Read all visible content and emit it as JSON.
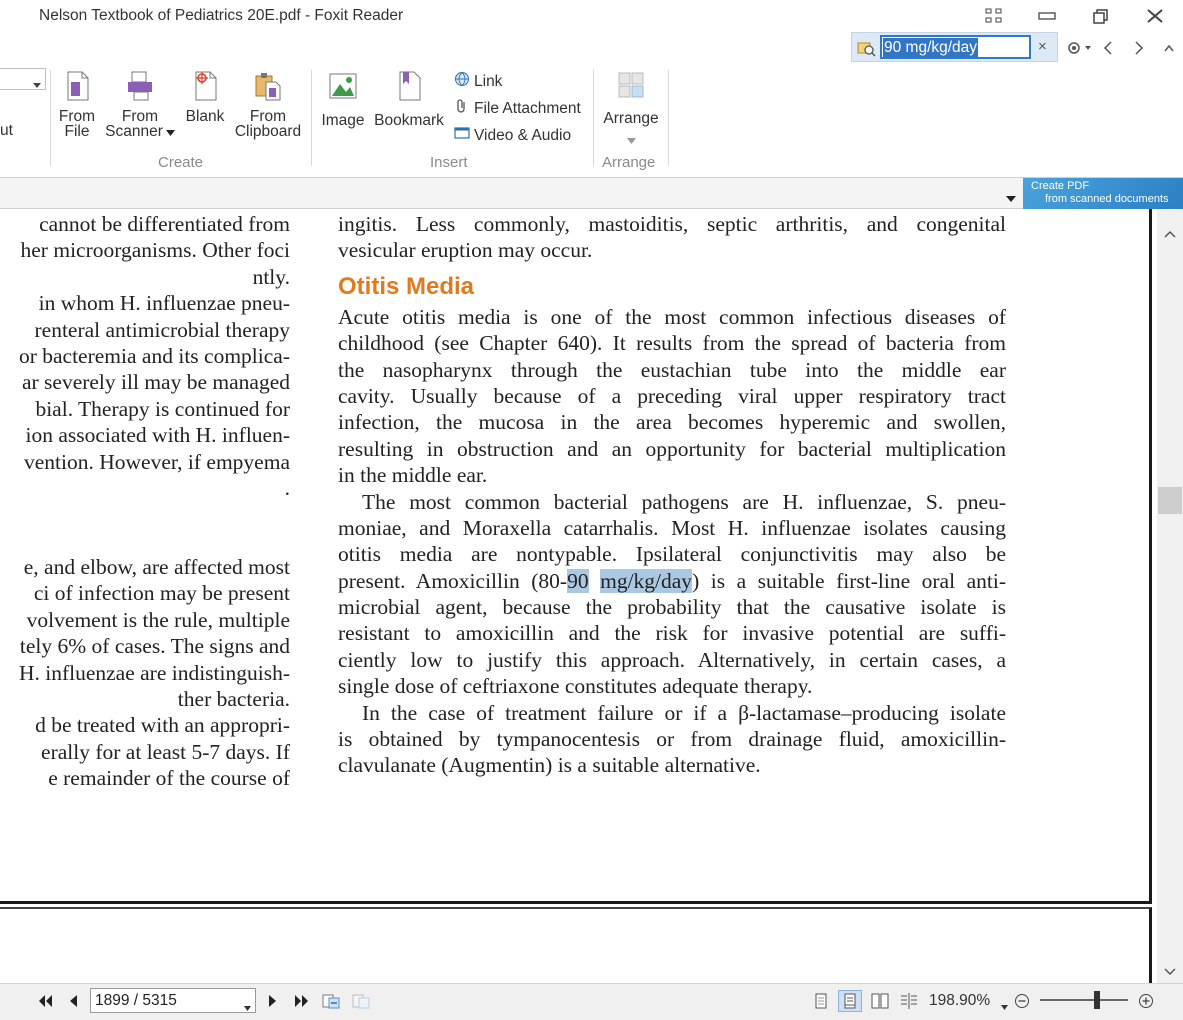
{
  "window": {
    "title": "Nelson Textbook of Pediatrics 20E.pdf - Foxit Reader"
  },
  "find": {
    "query": "90 mg/kg/day",
    "clear_glyph": "×"
  },
  "ribbon": {
    "partial_left_label": "ut",
    "create": {
      "from_file": [
        "From",
        "File"
      ],
      "from_scanner": [
        "From",
        "Scanner"
      ],
      "blank": "Blank",
      "from_clipboard": [
        "From",
        "Clipboard"
      ],
      "group_label": "Create"
    },
    "insert": {
      "image": "Image",
      "bookmark": "Bookmark",
      "link": "Link",
      "file_attachment": "File Attachment",
      "video_audio": "Video & Audio",
      "group_label": "Insert"
    },
    "arrange": {
      "arrange": "Arrange",
      "group_label": "Arrange"
    }
  },
  "promo": {
    "line1": "Create PDF",
    "line2": "from scanned documents"
  },
  "document": {
    "left_column": [
      "cannot be differentiated from",
      "her microorganisms. Other foci",
      "ntly.",
      "in whom H. influenzae pneu-",
      "renteral antimicrobial therapy",
      "or bacteremia and its complica-",
      "ar severely ill may be managed",
      "bial. Therapy is continued for",
      "ion associated with H. influen-",
      "vention. However, if empyema",
      ".",
      "",
      "",
      "e, and elbow, are affected most",
      "ci of infection may be present",
      "volvement is the rule, multiple",
      "tely 6% of cases. The signs and",
      "H. influenzae are indistinguish-",
      "ther bacteria.",
      "d be treated with an appropri-",
      "erally for at least 5-7 days. If",
      "e remainder of the course of"
    ],
    "right_top": [
      "ingitis. Less commonly, mastoiditis, septic arthritis, and congenital",
      "vesicular eruption may occur."
    ],
    "heading": "Otitis Media",
    "para1": [
      "Acute otitis media is one of the most common infectious diseases of",
      "childhood (see Chapter 640). It results from the spread of bacteria from",
      "the nasopharynx through the eustachian tube into the middle ear",
      "cavity. Usually because of a preceding viral upper respiratory tract",
      "infection, the mucosa in the area becomes hyperemic and swollen,",
      "resulting in obstruction and an opportunity for bacterial multiplication",
      "in the middle ear."
    ],
    "para2": {
      "l1": "The most common bacterial pathogens are H. influenzae, S. pneu-",
      "l2": "moniae, and Moraxella catarrhalis. Most H. influenzae isolates causing",
      "l3": "otitis media are nontypable. Ipsilateral conjunctivitis may also be",
      "l4_pre": "present. Amoxicillin (80-",
      "l4_hl1": "90",
      "l4_hl2": "mg/kg/day",
      "l4_post": ") is a suitable first-line oral anti-",
      "l5": "microbial agent, because the probability that the causative isolate is",
      "l6": "resistant to amoxicillin and the risk for invasive potential are suffi-",
      "l7": "ciently low to justify this approach. Alternatively, in certain cases, a",
      "l8": "single dose of ceftriaxone constitutes adequate therapy."
    },
    "para3": [
      "In the case of treatment failure or if a β-lactamase–producing isolate",
      "is obtained by tympanocentesis or from drainage fluid, amoxicillin-",
      "clavulanate (Augmentin) is a suitable alternative."
    ]
  },
  "status": {
    "page_indicator": "1899 / 5315",
    "zoom": "198.90%"
  },
  "colors": {
    "heading": "#e07a1f",
    "highlight": "#aac8e2",
    "find_selection": "#3276c3"
  }
}
